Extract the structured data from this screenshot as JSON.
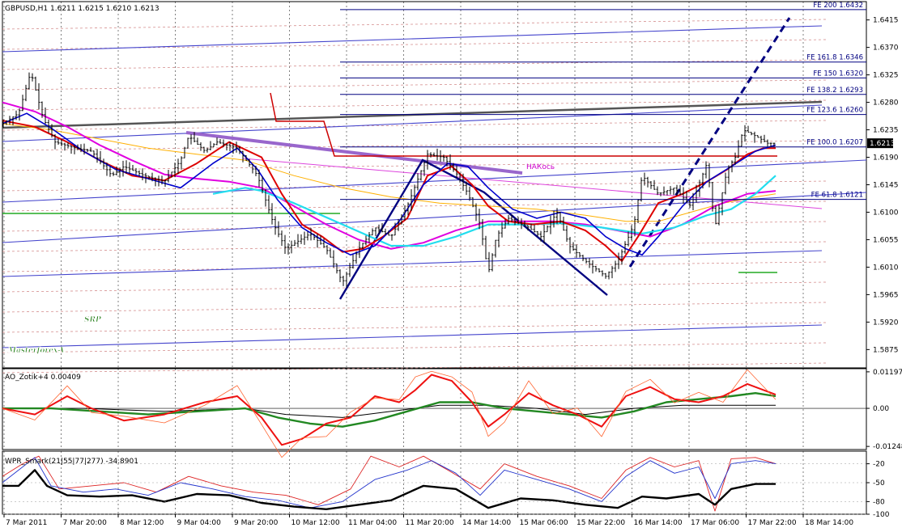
{
  "chart_data": {
    "type": "line",
    "symbol_header": "GBPUSD,H1  1.6211 1.6215 1.6210 1.6213",
    "watermark": [
      "SRP",
      "Masterforex-V"
    ],
    "colors": {
      "price_bar": "#000000",
      "ma_red": "#dd0000",
      "ma_magenta": "#e000e0",
      "ma_blue": "#0000cc",
      "ma_cyan": "#22ddee",
      "ma_orange": "#ffb000",
      "trend_navy": "#000080",
      "trend_purple": "#9966cc",
      "fib": "#000080",
      "grid": "#d08080"
    },
    "price_axis": {
      "ylim": [
        1.5845,
        1.6445
      ],
      "ticks": [
        "1.6415",
        "1.6370",
        "1.6325",
        "1.6280",
        "1.6235",
        "1.6190",
        "1.6145",
        "1.6100",
        "1.6055",
        "1.6010",
        "1.5965",
        "1.5920",
        "1.5875"
      ],
      "current_price": "1.6213"
    },
    "x_axis": {
      "labels": [
        "7 Mar 2011",
        "7 Mar 20:00",
        "8 Mar 12:00",
        "9 Mar 04:00",
        "9 Mar 20:00",
        "10 Mar 12:00",
        "11 Mar 04:00",
        "11 Mar 20:00",
        "14 Mar 14:00",
        "15 Mar 06:00",
        "15 Mar 22:00",
        "16 Mar 14:00",
        "17 Mar 06:00",
        "17 Mar 22:00",
        "18 Mar 14:00"
      ]
    },
    "fib_levels": [
      {
        "label": "FE 200  1.6432",
        "value": 1.6432
      },
      {
        "label": "FE 161.8  1.6346",
        "value": 1.6346
      },
      {
        "label": "FE 150  1.6320",
        "value": 1.632
      },
      {
        "label": "FE 138.2  1.6293",
        "value": 1.6293
      },
      {
        "label": "FE 123.6  1.6260",
        "value": 1.626
      },
      {
        "label": "FE 100.0  1.6207",
        "value": 1.6207
      },
      {
        "label": "FE 61.8  1.6121",
        "value": 1.6121
      }
    ],
    "annotations": [
      "НАКось"
    ],
    "price_series": [
      [
        0,
        1.6245
      ],
      [
        20,
        1.6262
      ],
      [
        35,
        1.633
      ],
      [
        50,
        1.6255
      ],
      [
        65,
        1.6215
      ],
      [
        90,
        1.6205
      ],
      [
        110,
        1.62
      ],
      [
        135,
        1.616
      ],
      [
        150,
        1.6175
      ],
      [
        175,
        1.616
      ],
      [
        200,
        1.615
      ],
      [
        220,
        1.6185
      ],
      [
        230,
        1.6225
      ],
      [
        250,
        1.62
      ],
      [
        265,
        1.6215
      ],
      [
        290,
        1.6205
      ],
      [
        315,
        1.616
      ],
      [
        335,
        1.608
      ],
      [
        350,
        1.604
      ],
      [
        380,
        1.6065
      ],
      [
        400,
        1.604
      ],
      [
        420,
        1.5985
      ],
      [
        440,
        1.604
      ],
      [
        460,
        1.6075
      ],
      [
        480,
        1.606
      ],
      [
        500,
        1.611
      ],
      [
        525,
        1.6195
      ],
      [
        545,
        1.619
      ],
      [
        560,
        1.6165
      ],
      [
        575,
        1.613
      ],
      [
        590,
        1.608
      ],
      [
        600,
        1.6
      ],
      [
        610,
        1.606
      ],
      [
        625,
        1.609
      ],
      [
        650,
        1.6075
      ],
      [
        665,
        1.606
      ],
      [
        685,
        1.61
      ],
      [
        700,
        1.6045
      ],
      [
        720,
        1.602
      ],
      [
        745,
        1.5995
      ],
      [
        760,
        1.602
      ],
      [
        780,
        1.608
      ],
      [
        790,
        1.616
      ],
      [
        810,
        1.613
      ],
      [
        830,
        1.614
      ],
      [
        850,
        1.611
      ],
      [
        870,
        1.618
      ],
      [
        880,
        1.6075
      ],
      [
        895,
        1.617
      ],
      [
        905,
        1.619
      ],
      [
        915,
        1.6235
      ],
      [
        930,
        1.6225
      ],
      [
        945,
        1.6213
      ],
      [
        955,
        1.6213
      ]
    ],
    "ma_red": [
      [
        0,
        1.625
      ],
      [
        40,
        1.624
      ],
      [
        80,
        1.6215
      ],
      [
        120,
        1.6185
      ],
      [
        160,
        1.616
      ],
      [
        200,
        1.6152
      ],
      [
        240,
        1.618
      ],
      [
        280,
        1.6215
      ],
      [
        320,
        1.619
      ],
      [
        345,
        1.613
      ],
      [
        370,
        1.608
      ],
      [
        395,
        1.606
      ],
      [
        420,
        1.6035
      ],
      [
        445,
        1.604
      ],
      [
        470,
        1.606
      ],
      [
        500,
        1.609
      ],
      [
        525,
        1.616
      ],
      [
        555,
        1.6175
      ],
      [
        580,
        1.6145
      ],
      [
        600,
        1.611
      ],
      [
        625,
        1.6085
      ],
      [
        655,
        1.608
      ],
      [
        690,
        1.6085
      ],
      [
        720,
        1.607
      ],
      [
        745,
        1.6045
      ],
      [
        765,
        1.602
      ],
      [
        785,
        1.606
      ],
      [
        810,
        1.6115
      ],
      [
        840,
        1.613
      ],
      [
        870,
        1.615
      ],
      [
        895,
        1.617
      ],
      [
        920,
        1.6195
      ],
      [
        940,
        1.6205
      ],
      [
        955,
        1.6205
      ]
    ],
    "ma_blue": [
      [
        0,
        1.6245
      ],
      [
        30,
        1.6262
      ],
      [
        60,
        1.6238
      ],
      [
        100,
        1.62
      ],
      [
        140,
        1.617
      ],
      [
        180,
        1.6155
      ],
      [
        220,
        1.614
      ],
      [
        260,
        1.618
      ],
      [
        290,
        1.6205
      ],
      [
        315,
        1.617
      ],
      [
        340,
        1.612
      ],
      [
        370,
        1.6075
      ],
      [
        400,
        1.605
      ],
      [
        430,
        1.603
      ],
      [
        460,
        1.6045
      ],
      [
        490,
        1.6085
      ],
      [
        520,
        1.6145
      ],
      [
        550,
        1.618
      ],
      [
        575,
        1.6175
      ],
      [
        600,
        1.614
      ],
      [
        630,
        1.6105
      ],
      [
        660,
        1.609
      ],
      [
        690,
        1.61
      ],
      [
        720,
        1.609
      ],
      [
        745,
        1.606
      ],
      [
        770,
        1.604
      ],
      [
        790,
        1.603
      ],
      [
        810,
        1.606
      ],
      [
        840,
        1.611
      ],
      [
        870,
        1.615
      ],
      [
        900,
        1.6175
      ],
      [
        930,
        1.62
      ],
      [
        955,
        1.621
      ]
    ],
    "ma_magenta": [
      [
        0,
        1.628
      ],
      [
        40,
        1.6265
      ],
      [
        80,
        1.624
      ],
      [
        120,
        1.621
      ],
      [
        160,
        1.6185
      ],
      [
        200,
        1.6162
      ],
      [
        240,
        1.6155
      ],
      [
        280,
        1.615
      ],
      [
        320,
        1.614
      ],
      [
        360,
        1.611
      ],
      [
        400,
        1.608
      ],
      [
        440,
        1.6055
      ],
      [
        480,
        1.604
      ],
      [
        520,
        1.605
      ],
      [
        560,
        1.607
      ],
      [
        600,
        1.6085
      ],
      [
        640,
        1.6085
      ],
      [
        680,
        1.6085
      ],
      [
        720,
        1.608
      ],
      [
        760,
        1.607
      ],
      [
        800,
        1.606
      ],
      [
        840,
        1.608
      ],
      [
        880,
        1.611
      ],
      [
        920,
        1.613
      ],
      [
        955,
        1.6135
      ]
    ],
    "ma_cyan": [
      [
        260,
        1.613
      ],
      [
        300,
        1.614
      ],
      [
        320,
        1.6135
      ],
      [
        360,
        1.6115
      ],
      [
        420,
        1.608
      ],
      [
        480,
        1.6045
      ],
      [
        520,
        1.6045
      ],
      [
        560,
        1.606
      ],
      [
        600,
        1.608
      ],
      [
        640,
        1.608
      ],
      [
        690,
        1.6082
      ],
      [
        740,
        1.6075
      ],
      [
        790,
        1.6065
      ],
      [
        830,
        1.6075
      ],
      [
        870,
        1.6095
      ],
      [
        900,
        1.6105
      ],
      [
        930,
        1.613
      ],
      [
        955,
        1.616
      ]
    ],
    "ma_orange": [
      [
        0,
        1.6245
      ],
      [
        60,
        1.6235
      ],
      [
        120,
        1.622
      ],
      [
        180,
        1.6205
      ],
      [
        240,
        1.6195
      ],
      [
        300,
        1.6185
      ],
      [
        360,
        1.616
      ],
      [
        420,
        1.614
      ],
      [
        480,
        1.6125
      ],
      [
        540,
        1.6115
      ],
      [
        600,
        1.611
      ],
      [
        660,
        1.6105
      ],
      [
        720,
        1.6095
      ],
      [
        770,
        1.6085
      ],
      [
        810,
        1.6085
      ],
      [
        850,
        1.61
      ],
      [
        890,
        1.6115
      ],
      [
        930,
        1.6125
      ],
      [
        955,
        1.613
      ]
    ],
    "ao_panel": {
      "label": "AO_Zotik+4 0.00409",
      "ticks": [
        "0.01197",
        "0.00",
        "-0.01248"
      ],
      "ylim": [
        -0.0135,
        0.013
      ],
      "red": [
        [
          0,
          0.0
        ],
        [
          40,
          -0.002
        ],
        [
          80,
          0.004
        ],
        [
          110,
          0.0
        ],
        [
          150,
          -0.004
        ],
        [
          200,
          -0.002
        ],
        [
          250,
          0.002
        ],
        [
          290,
          0.004
        ],
        [
          320,
          -0.003
        ],
        [
          345,
          -0.012
        ],
        [
          370,
          -0.01
        ],
        [
          400,
          -0.005
        ],
        [
          430,
          -0.003
        ],
        [
          460,
          0.004
        ],
        [
          490,
          0.002
        ],
        [
          510,
          0.006
        ],
        [
          530,
          0.011
        ],
        [
          555,
          0.009
        ],
        [
          580,
          0.002
        ],
        [
          600,
          -0.006
        ],
        [
          620,
          -0.002
        ],
        [
          650,
          0.005
        ],
        [
          680,
          0.001
        ],
        [
          710,
          -0.002
        ],
        [
          740,
          -0.006
        ],
        [
          770,
          0.004
        ],
        [
          800,
          0.007
        ],
        [
          830,
          0.003
        ],
        [
          860,
          0.002
        ],
        [
          890,
          0.004
        ],
        [
          920,
          0.008
        ],
        [
          955,
          0.0045
        ]
      ],
      "green": [
        [
          0,
          0.0
        ],
        [
          60,
          0.0
        ],
        [
          120,
          -0.001
        ],
        [
          180,
          -0.002
        ],
        [
          240,
          -0.001
        ],
        [
          300,
          0.0
        ],
        [
          340,
          -0.003
        ],
        [
          380,
          -0.005
        ],
        [
          420,
          -0.006
        ],
        [
          460,
          -0.004
        ],
        [
          500,
          -0.001
        ],
        [
          540,
          0.002
        ],
        [
          580,
          0.002
        ],
        [
          620,
          0.0
        ],
        [
          660,
          -0.001
        ],
        [
          700,
          -0.002
        ],
        [
          740,
          -0.003
        ],
        [
          780,
          -0.001
        ],
        [
          820,
          0.002
        ],
        [
          860,
          0.003
        ],
        [
          900,
          0.004
        ],
        [
          930,
          0.005
        ],
        [
          955,
          0.004
        ]
      ],
      "black": [
        [
          0,
          0.0
        ],
        [
          100,
          0.0
        ],
        [
          200,
          -0.001
        ],
        [
          300,
          0.0
        ],
        [
          350,
          -0.002
        ],
        [
          420,
          -0.003
        ],
        [
          480,
          -0.001
        ],
        [
          540,
          0.001
        ],
        [
          600,
          0.001
        ],
        [
          660,
          0.0
        ],
        [
          720,
          -0.002
        ],
        [
          780,
          0.0
        ],
        [
          840,
          0.001
        ],
        [
          900,
          0.001
        ],
        [
          955,
          0.001
        ]
      ]
    },
    "wpr_panel": {
      "label": "WPR_Smark(21|55|77|277) -34.8901",
      "ticks": [
        "-20",
        "-50",
        "-80",
        "-100"
      ],
      "ylim": [
        -100,
        0
      ],
      "black": [
        [
          0,
          -55
        ],
        [
          20,
          -55
        ],
        [
          40,
          -30
        ],
        [
          55,
          -55
        ],
        [
          80,
          -70
        ],
        [
          120,
          -72
        ],
        [
          160,
          -70
        ],
        [
          200,
          -80
        ],
        [
          240,
          -68
        ],
        [
          280,
          -70
        ],
        [
          320,
          -82
        ],
        [
          360,
          -88
        ],
        [
          400,
          -92
        ],
        [
          440,
          -85
        ],
        [
          480,
          -78
        ],
        [
          520,
          -55
        ],
        [
          560,
          -60
        ],
        [
          600,
          -90
        ],
        [
          640,
          -75
        ],
        [
          680,
          -78
        ],
        [
          720,
          -85
        ],
        [
          760,
          -90
        ],
        [
          790,
          -72
        ],
        [
          820,
          -75
        ],
        [
          860,
          -68
        ],
        [
          880,
          -85
        ],
        [
          900,
          -60
        ],
        [
          930,
          -52
        ],
        [
          955,
          -52
        ]
      ],
      "blue": [
        [
          0,
          -50
        ],
        [
          20,
          -30
        ],
        [
          40,
          -10
        ],
        [
          60,
          -55
        ],
        [
          100,
          -65
        ],
        [
          140,
          -60
        ],
        [
          180,
          -70
        ],
        [
          220,
          -50
        ],
        [
          260,
          -60
        ],
        [
          300,
          -72
        ],
        [
          340,
          -78
        ],
        [
          380,
          -90
        ],
        [
          420,
          -80
        ],
        [
          460,
          -45
        ],
        [
          500,
          -30
        ],
        [
          530,
          -15
        ],
        [
          560,
          -35
        ],
        [
          590,
          -70
        ],
        [
          620,
          -30
        ],
        [
          660,
          -45
        ],
        [
          700,
          -60
        ],
        [
          740,
          -80
        ],
        [
          770,
          -40
        ],
        [
          800,
          -15
        ],
        [
          830,
          -35
        ],
        [
          860,
          -25
        ],
        [
          880,
          -75
        ],
        [
          900,
          -20
        ],
        [
          930,
          -15
        ],
        [
          955,
          -20
        ]
      ],
      "red": [
        [
          0,
          -40
        ],
        [
          25,
          -20
        ],
        [
          45,
          -8
        ],
        [
          70,
          -60
        ],
        [
          110,
          -55
        ],
        [
          150,
          -50
        ],
        [
          190,
          -65
        ],
        [
          230,
          -40
        ],
        [
          270,
          -55
        ],
        [
          310,
          -65
        ],
        [
          350,
          -70
        ],
        [
          390,
          -85
        ],
        [
          430,
          -60
        ],
        [
          455,
          -8
        ],
        [
          490,
          -25
        ],
        [
          520,
          -8
        ],
        [
          550,
          -30
        ],
        [
          590,
          -60
        ],
        [
          620,
          -20
        ],
        [
          660,
          -40
        ],
        [
          700,
          -55
        ],
        [
          740,
          -75
        ],
        [
          770,
          -30
        ],
        [
          800,
          -10
        ],
        [
          830,
          -25
        ],
        [
          860,
          -15
        ],
        [
          880,
          -95
        ],
        [
          900,
          -12
        ],
        [
          930,
          -10
        ],
        [
          955,
          -20
        ]
      ]
    }
  }
}
